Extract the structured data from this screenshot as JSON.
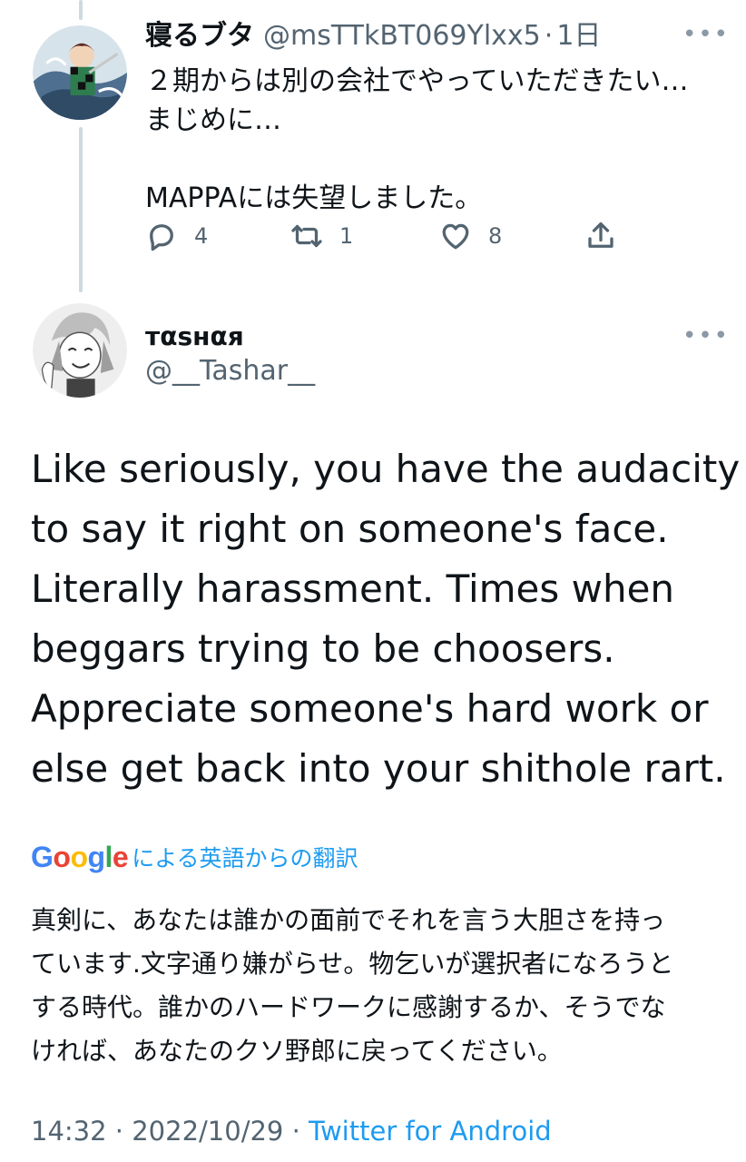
{
  "reply": {
    "name": "寝るブタ",
    "handle": "@msTTkBT069Ylxx5",
    "sep": "·",
    "time": "1日",
    "lines": [
      "２期からは別の会社でやっていただきたい…",
      "まじめに…",
      "",
      "MAPPAには失望しました。"
    ],
    "actions": {
      "reply_count": "4",
      "retweet_count": "1",
      "like_count": "8"
    }
  },
  "main_tweet": {
    "name": "тαѕнαя",
    "handle": "@__Tashar__",
    "text_lines": [
      "Like seriously, you have the audacity",
      "to say it right on someone's face.",
      "Literally harassment. Times when",
      "beggars trying to be choosers.",
      "Appreciate someone's hard work or",
      "else get back into your shithole rart."
    ],
    "translate": {
      "provider_letters": [
        "G",
        "o",
        "o",
        "g",
        "l",
        "e"
      ],
      "provider_colors": [
        "#4285F4",
        "#EA4335",
        "#FBBC05",
        "#4285F4",
        "#34A853",
        "#EA4335"
      ],
      "label": "による英語からの翻訳"
    },
    "translation_lines": [
      "真剣に、あなたは誰かの面前でそれを言う大胆さを持っ",
      "ています.文字通り嫌がらせ。物乞いが選択者になろうと",
      "する時代。誰かのハードワークに感謝するか、そうでな",
      "ければ、あなたのクソ野郎に戻ってください。"
    ],
    "meta": {
      "time": "14:32",
      "sep": "·",
      "date": "2022/10/29",
      "source": "Twitter for Android"
    }
  },
  "icons": {
    "more": "more-icon",
    "reply": "reply-icon",
    "retweet": "retweet-icon",
    "like": "heart-icon",
    "share": "share-icon"
  },
  "colors": {
    "accent": "#1d9bf0",
    "secondary_text": "#536471",
    "primary_text": "#0f1419",
    "thread_line": "#cfd9de"
  }
}
